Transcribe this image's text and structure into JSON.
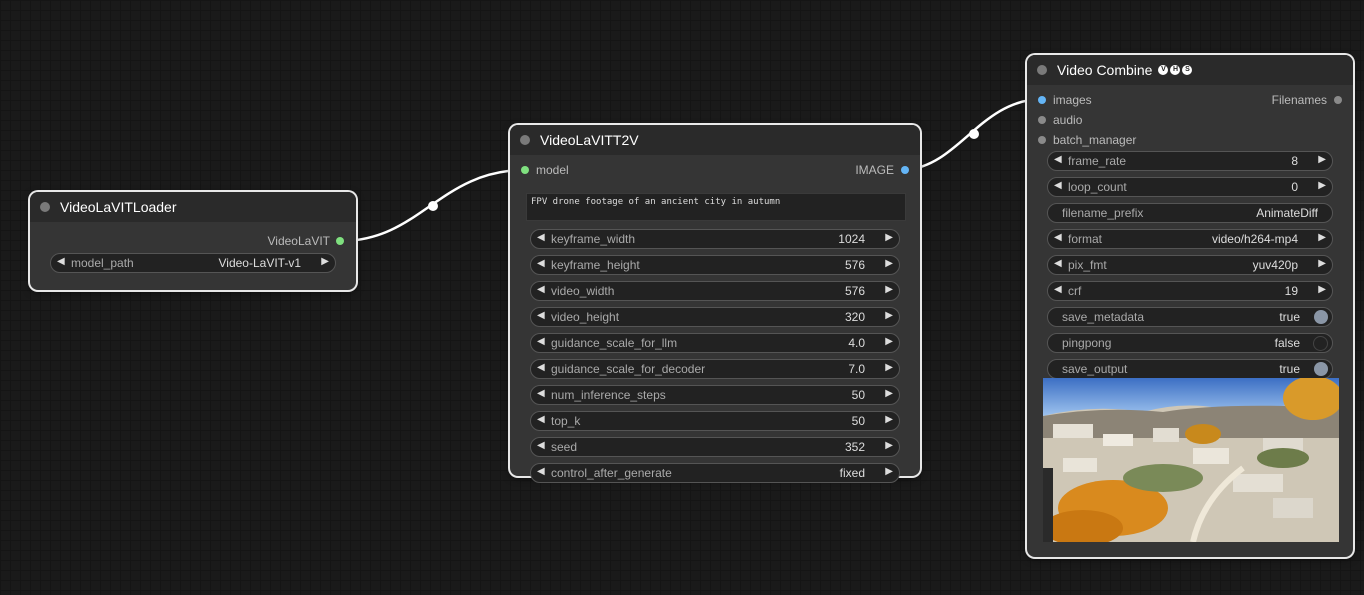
{
  "loader": {
    "title": "VideoLaVITLoader",
    "output_label": "VideoLaVIT",
    "widget": {
      "label": "model_path",
      "value": "Video-LaVIT-v1"
    }
  },
  "t2v": {
    "title": "VideoLaVITT2V",
    "input_label": "model",
    "output_label": "IMAGE",
    "prompt": "FPV drone footage of an ancient city in autumn",
    "widgets": [
      {
        "label": "keyframe_width",
        "value": "1024"
      },
      {
        "label": "keyframe_height",
        "value": "576"
      },
      {
        "label": "video_width",
        "value": "576"
      },
      {
        "label": "video_height",
        "value": "320"
      },
      {
        "label": "guidance_scale_for_llm",
        "value": "4.0"
      },
      {
        "label": "guidance_scale_for_decoder",
        "value": "7.0"
      },
      {
        "label": "num_inference_steps",
        "value": "50"
      },
      {
        "label": "top_k",
        "value": "50"
      },
      {
        "label": "seed",
        "value": "352"
      },
      {
        "label": "control_after_generate",
        "value": "fixed"
      }
    ]
  },
  "combine": {
    "title": "Video Combine",
    "icon_letters": [
      "V",
      "H",
      "S"
    ],
    "inputs": [
      "images",
      "audio",
      "batch_manager"
    ],
    "output_label": "Filenames",
    "widgets": [
      {
        "label": "frame_rate",
        "value": "8",
        "kind": "number"
      },
      {
        "label": "loop_count",
        "value": "0",
        "kind": "number"
      },
      {
        "label": "filename_prefix",
        "value": "AnimateDiff",
        "kind": "text"
      },
      {
        "label": "format",
        "value": "video/h264-mp4",
        "kind": "combo"
      },
      {
        "label": "pix_fmt",
        "value": "yuv420p",
        "kind": "combo"
      },
      {
        "label": "crf",
        "value": "19",
        "kind": "number"
      },
      {
        "label": "save_metadata",
        "value": "true",
        "kind": "toggle",
        "on": true
      },
      {
        "label": "pingpong",
        "value": "false",
        "kind": "toggle",
        "on": false
      },
      {
        "label": "save_output",
        "value": "true",
        "kind": "toggle",
        "on": true
      }
    ]
  },
  "colors": {
    "model_slot": "#7fe07f",
    "image_slot": "#64b5f6",
    "generic_slot": "#8a8a8a",
    "link": "#ffffff"
  },
  "icons": {
    "arrow_left": "◀",
    "arrow_right": "▶",
    "header_dot": "node-collapse-dot"
  }
}
